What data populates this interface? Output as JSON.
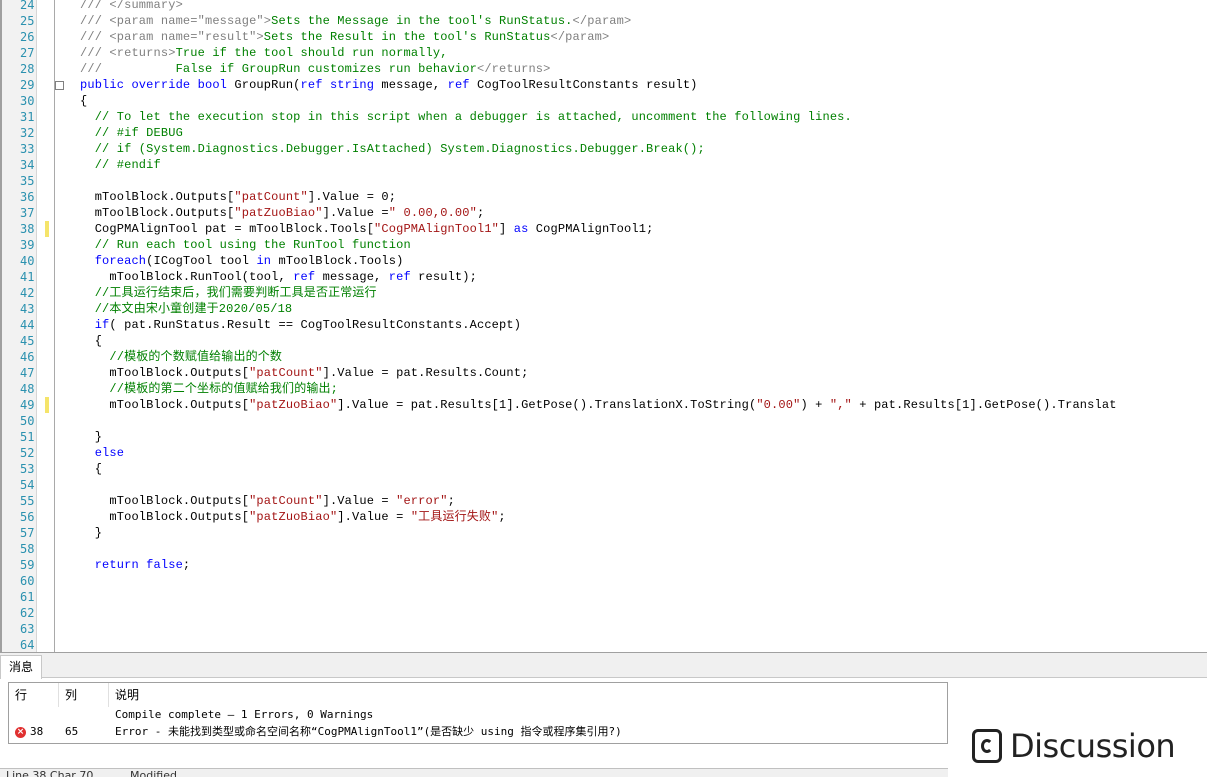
{
  "editor": {
    "first_line": 24,
    "line_count": 41,
    "changed_lines": [
      38,
      49
    ],
    "lines": [
      [
        [
          "xd",
          "/// </summary>"
        ]
      ],
      [
        [
          "xd",
          "/// <param name=\"message\">"
        ],
        [
          "cm",
          "Sets the Message in the tool's RunStatus."
        ],
        [
          "xd",
          "</param>"
        ]
      ],
      [
        [
          "xd",
          "/// <param name=\"result\">"
        ],
        [
          "cm",
          "Sets the Result in the tool's RunStatus"
        ],
        [
          "xd",
          "</param>"
        ]
      ],
      [
        [
          "xd",
          "/// <returns>"
        ],
        [
          "cm",
          "True if the tool should run normally,"
        ]
      ],
      [
        [
          "xd",
          "///          "
        ],
        [
          "cm",
          "False if GroupRun customizes run behavior"
        ],
        [
          "xd",
          "</returns>"
        ]
      ],
      [
        [
          "kw",
          "public override bool "
        ],
        [
          "tx",
          "GroupRun("
        ],
        [
          "kw",
          "ref string "
        ],
        [
          "tx",
          "message, "
        ],
        [
          "kw",
          "ref "
        ],
        [
          "tx",
          "CogToolResultConstants result)"
        ]
      ],
      [
        [
          "tx",
          "{"
        ]
      ],
      [
        [
          "cm",
          "  // To let the execution stop in this script when a debugger is attached, uncomment the following lines."
        ]
      ],
      [
        [
          "cm",
          "  // #if DEBUG"
        ]
      ],
      [
        [
          "cm",
          "  // if (System.Diagnostics.Debugger.IsAttached) System.Diagnostics.Debugger.Break();"
        ]
      ],
      [
        [
          "cm",
          "  // #endif"
        ]
      ],
      [
        [
          "tx",
          ""
        ]
      ],
      [
        [
          "tx",
          "  mToolBlock.Outputs["
        ],
        [
          "st",
          "\"patCount\""
        ],
        [
          "tx",
          "].Value = 0;"
        ]
      ],
      [
        [
          "tx",
          "  mToolBlock.Outputs["
        ],
        [
          "st",
          "\"patZuoBiao\""
        ],
        [
          "tx",
          "].Value ="
        ],
        [
          "st",
          "\" 0.00,0.00\""
        ],
        [
          "tx",
          ";"
        ]
      ],
      [
        [
          "tx",
          "  CogPMAlignTool pat = mToolBlock.Tools["
        ],
        [
          "st",
          "\"CogPMAlignTool1\""
        ],
        [
          "tx",
          "] "
        ],
        [
          "kw",
          "as "
        ],
        [
          "tx",
          "CogPMAlignTool1;"
        ]
      ],
      [
        [
          "cm",
          "  // Run each tool using the RunTool function"
        ]
      ],
      [
        [
          "kw",
          "  foreach"
        ],
        [
          "tx",
          "(ICogTool tool "
        ],
        [
          "kw",
          "in "
        ],
        [
          "tx",
          "mToolBlock.Tools)"
        ]
      ],
      [
        [
          "tx",
          "    mToolBlock.RunTool(tool, "
        ],
        [
          "kw",
          "ref "
        ],
        [
          "tx",
          "message, "
        ],
        [
          "kw",
          "ref "
        ],
        [
          "tx",
          "result);"
        ]
      ],
      [
        [
          "cm",
          "  //工具运行结束后，我们需要判断工具是否正常运行"
        ]
      ],
      [
        [
          "cm",
          "  //本文由宋小童创建于2020/05/18"
        ]
      ],
      [
        [
          "kw",
          "  if"
        ],
        [
          "tx",
          "( pat.RunStatus.Result == CogToolResultConstants.Accept)"
        ]
      ],
      [
        [
          "tx",
          "  {"
        ]
      ],
      [
        [
          "cm",
          "    //模板的个数赋值给输出的个数"
        ]
      ],
      [
        [
          "tx",
          "    mToolBlock.Outputs["
        ],
        [
          "st",
          "\"patCount\""
        ],
        [
          "tx",
          "].Value = pat.Results.Count;"
        ]
      ],
      [
        [
          "cm",
          "    //模板的第二个坐标的值赋给我们的输出;"
        ]
      ],
      [
        [
          "tx",
          "    mToolBlock.Outputs["
        ],
        [
          "st",
          "\"patZuoBiao\""
        ],
        [
          "tx",
          "].Value = pat.Results[1].GetPose().TranslationX.ToString("
        ],
        [
          "st",
          "\"0.00\""
        ],
        [
          "tx",
          ") + "
        ],
        [
          "st",
          "\",\""
        ],
        [
          "tx",
          " + pat.Results[1].GetPose().Translat"
        ]
      ],
      [
        [
          "tx",
          ""
        ]
      ],
      [
        [
          "tx",
          "  }"
        ]
      ],
      [
        [
          "kw",
          "  else"
        ]
      ],
      [
        [
          "tx",
          "  {"
        ]
      ],
      [
        [
          "tx",
          ""
        ]
      ],
      [
        [
          "tx",
          "    mToolBlock.Outputs["
        ],
        [
          "st",
          "\"patCount\""
        ],
        [
          "tx",
          "].Value = "
        ],
        [
          "st",
          "\"error\""
        ],
        [
          "tx",
          ";"
        ]
      ],
      [
        [
          "tx",
          "    mToolBlock.Outputs["
        ],
        [
          "st",
          "\"patZuoBiao\""
        ],
        [
          "tx",
          "].Value = "
        ],
        [
          "st",
          "\"工具运行失败\""
        ],
        [
          "tx",
          ";"
        ]
      ],
      [
        [
          "tx",
          "  }"
        ]
      ],
      [
        [
          "tx",
          ""
        ]
      ],
      [
        [
          "kw",
          "  return false"
        ],
        [
          "tx",
          ";"
        ]
      ],
      [
        [
          "tx",
          ""
        ]
      ],
      [
        [
          "tx",
          ""
        ]
      ],
      [
        [
          "tx",
          ""
        ]
      ],
      [
        [
          "tx",
          ""
        ]
      ],
      [
        [
          "tx",
          ""
        ]
      ]
    ]
  },
  "messages": {
    "tab_label": "消息",
    "col_line": "行",
    "col_col": "列",
    "col_desc": "说明",
    "summary": "Compile complete — 1 Errors, 0 Warnings",
    "error_line": "38",
    "error_col": "65",
    "error_text": "Error - 未能找到类型或命名空间名称“CogPMAlignTool1”(是否缺少 using 指令或程序集引用?)",
    "error_icon": "error-x-icon"
  },
  "status": {
    "position": "Line 38  Char 70",
    "state": "Modified"
  },
  "watermark": {
    "text": "Discussion"
  },
  "colors": {
    "keyword": "#0000ff",
    "comment": "#008000",
    "string": "#a31515",
    "xml_doc": "#808080",
    "line_number": "#2b91af",
    "change_mark": "#f5e46a"
  }
}
